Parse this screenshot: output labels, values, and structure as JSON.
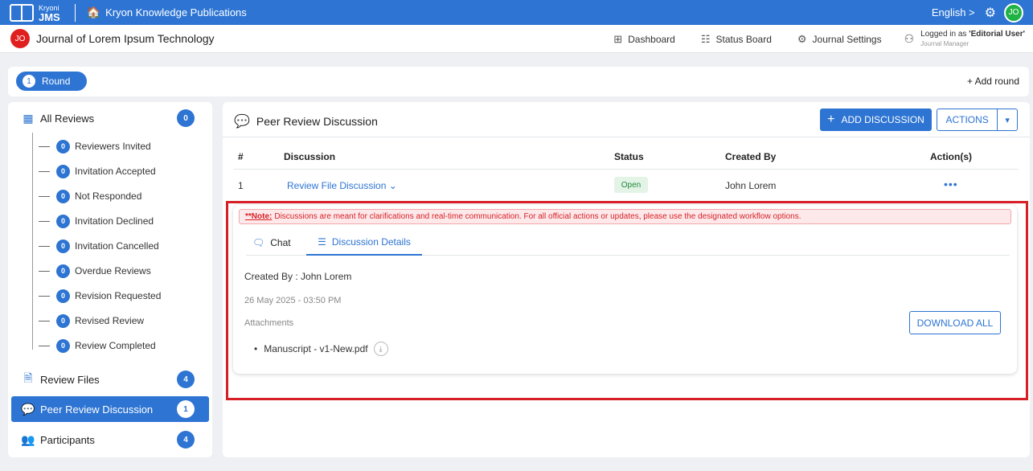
{
  "topbar": {
    "logo_line1": "Kryoni",
    "logo_line2": "JMS",
    "app_title": "Kryon Knowledge Publications",
    "language": "English >",
    "user_initials": "JO"
  },
  "subheader": {
    "journal_initials": "JO",
    "journal_title": "Journal of Lorem Ipsum Technology",
    "nav": [
      "Dashboard",
      "Status Board",
      "Journal Settings"
    ],
    "logged_prefix": "Logged in as ",
    "logged_user": "'Editorial User'",
    "role": "Journal Manager"
  },
  "round": {
    "number": "1",
    "label": "Round",
    "add_label": "+ Add round"
  },
  "sidebar": {
    "all_reviews": {
      "label": "All Reviews",
      "count": "0"
    },
    "sub_items": [
      {
        "label": "Reviewers Invited",
        "count": "0"
      },
      {
        "label": "Invitation Accepted",
        "count": "0"
      },
      {
        "label": "Not Responded",
        "count": "0"
      },
      {
        "label": "Invitation Declined",
        "count": "0"
      },
      {
        "label": "Invitation Cancelled",
        "count": "0"
      },
      {
        "label": "Overdue Reviews",
        "count": "0"
      },
      {
        "label": "Revision Requested",
        "count": "0"
      },
      {
        "label": "Revised Review",
        "count": "0"
      },
      {
        "label": "Review Completed",
        "count": "0"
      }
    ],
    "review_files": {
      "label": "Review Files",
      "count": "4"
    },
    "peer_review": {
      "label": "Peer Review Discussion",
      "count": "1"
    },
    "participants": {
      "label": "Participants",
      "count": "4"
    }
  },
  "main": {
    "title": "Peer Review Discussion",
    "add_button": "ADD DISCUSSION",
    "actions_button": "ACTIONS",
    "columns": [
      "#",
      "Discussion",
      "Status",
      "Created By",
      "Action(s)"
    ],
    "row": {
      "index": "1",
      "discussion": "Review File Discussion",
      "status": "Open",
      "created_by": "John Lorem",
      "actions": "•••"
    }
  },
  "detail": {
    "note_label": "**Note:",
    "note_text": "Discussions are meant for clarifications and real-time communication. For all official actions or updates, please use the designated workflow options.",
    "tab_chat": "Chat",
    "tab_details": "Discussion Details",
    "created_by": "Created By : John Lorem",
    "date": "26 May 2025 - 03:50 PM",
    "attachments_label": "Attachments",
    "file_name": "Manuscript - v1-New.pdf",
    "download_all": "DOWNLOAD ALL"
  },
  "colors": {
    "primary": "#2d74d3",
    "highlight": "#d61f26",
    "status_open": "#1f8a3a"
  }
}
